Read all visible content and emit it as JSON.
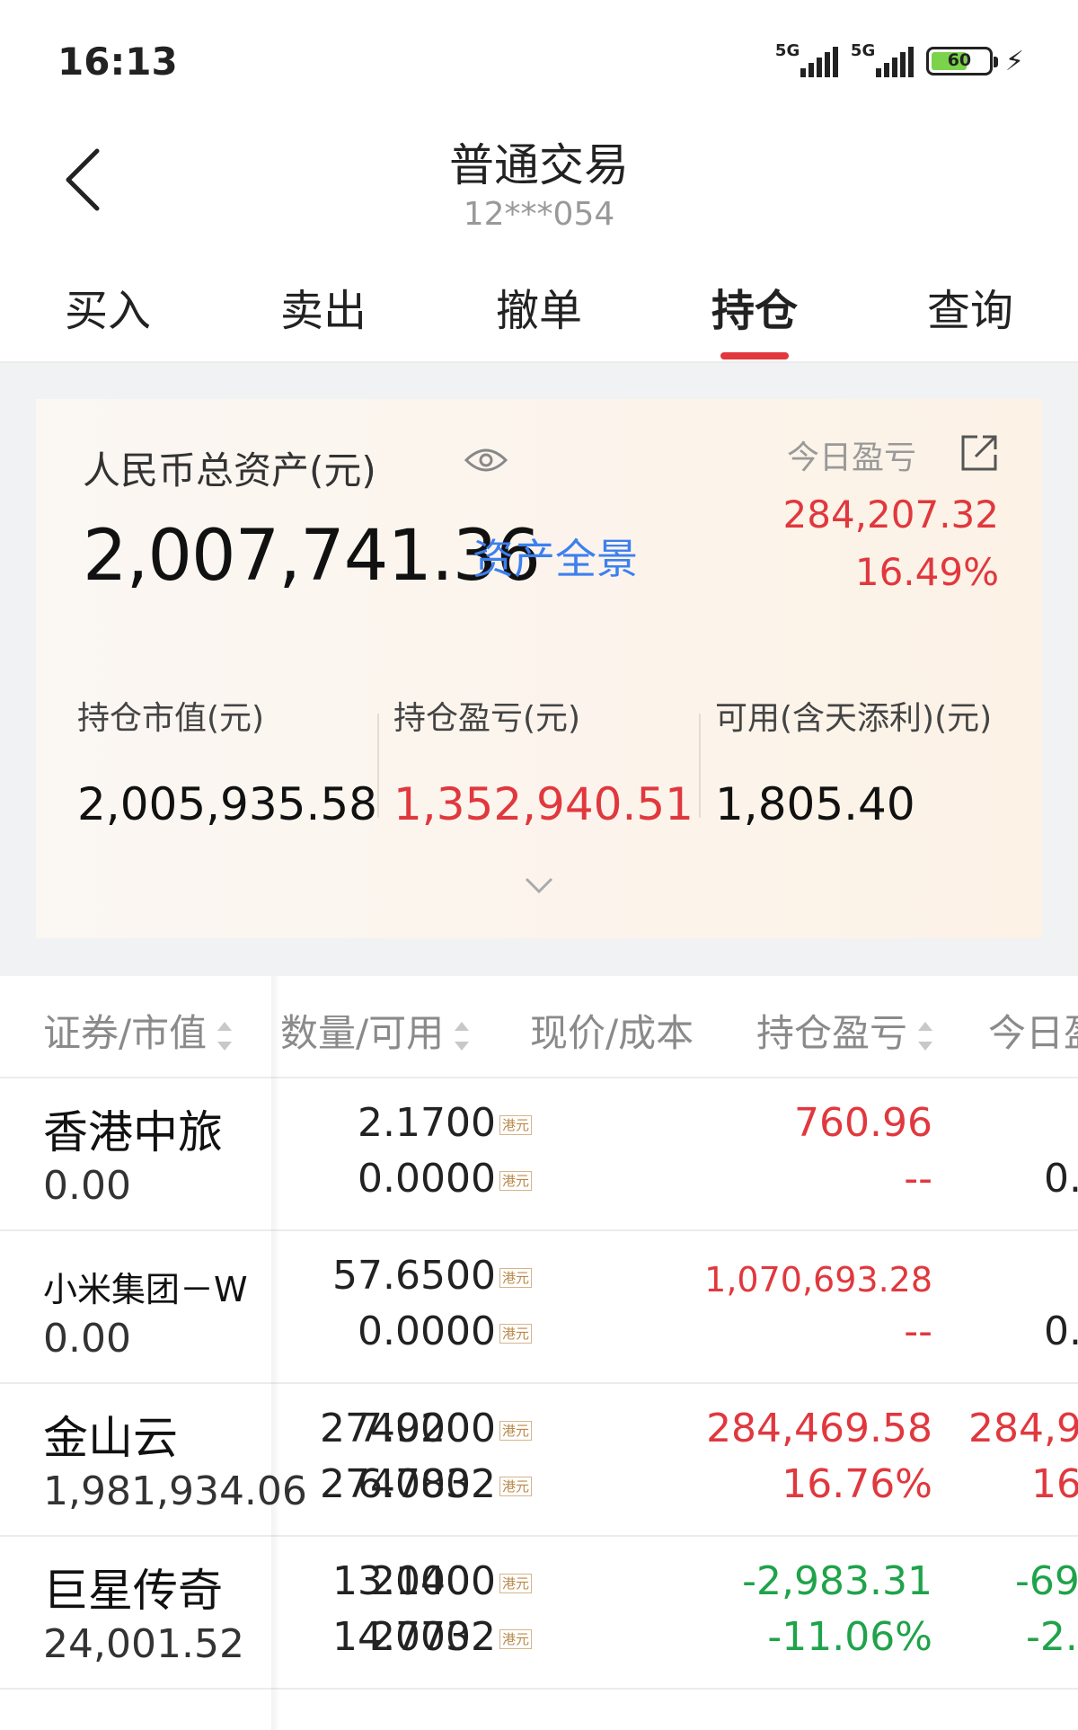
{
  "status_bar": {
    "time": "16:13",
    "signal1": "5G",
    "signal2": "5G",
    "battery": "60"
  },
  "nav": {
    "title": "普通交易",
    "account": "12***054"
  },
  "tabs": [
    {
      "label": "买入"
    },
    {
      "label": "卖出"
    },
    {
      "label": "撤单"
    },
    {
      "label": "持仓",
      "active": true
    },
    {
      "label": "查询"
    }
  ],
  "asset_card": {
    "label": "人民币总资产(元)",
    "total": "2,007,741.36",
    "panorama": "资产全景",
    "today_label": "今日盈亏",
    "today_value": "284,207.32",
    "today_pct": "16.49%",
    "metrics": [
      {
        "label": "持仓市值(元)",
        "value": "2,005,935.58"
      },
      {
        "label": "持仓盈亏(元)",
        "value": "1,352,940.51"
      },
      {
        "label": "可用(含天添利)(元)",
        "value": "1,805.40"
      }
    ]
  },
  "table": {
    "headers": [
      "证券/市值",
      "数量/可用",
      "现价/成本",
      "持仓盈亏",
      "今日盈"
    ],
    "currency": "港元",
    "rows": [
      {
        "name": "香港中旅",
        "market_value": "0.00",
        "qty": "0",
        "avail": "0",
        "price": "2.1700",
        "cost": "0.0000",
        "pnl": "760.96",
        "pnl_pct": "--",
        "today": "",
        "today_pct": "0."
      },
      {
        "name": "小米集团－W",
        "market_value": "0.00",
        "qty": "0",
        "avail": "0",
        "price": "57.6500",
        "cost": "0.0000",
        "pnl": "1,070,693.28",
        "pnl_pct": "--",
        "today": "",
        "today_pct": "0."
      },
      {
        "name": "金山云",
        "market_value": "1,981,934.06",
        "qty": "274000",
        "avail": "274000",
        "price": "7.9200",
        "cost": "6.7832",
        "pnl": "284,469.58",
        "pnl_pct": "16.76%",
        "today": "284,90",
        "today_pct": "16."
      },
      {
        "name": "巨星传奇",
        "market_value": "24,001.52",
        "qty": "2000",
        "avail": "2000",
        "price": "13.1400",
        "cost": "14.7732",
        "pnl": "-2,983.31",
        "pnl_pct": "-11.06%",
        "today": "-69",
        "today_pct": "-2."
      }
    ]
  },
  "colors": {
    "red": "#e0383e",
    "green": "#1fa34a",
    "blue": "#3d7ff0",
    "tab_indicator": "#e0383e"
  }
}
